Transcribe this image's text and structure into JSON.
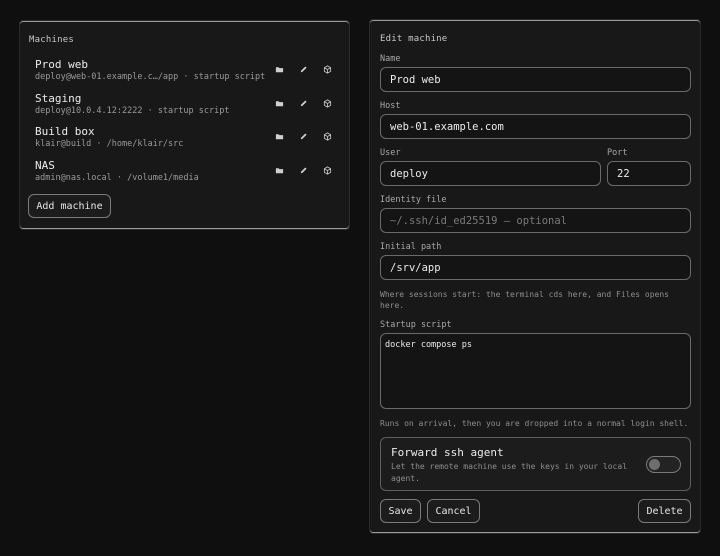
{
  "machines_panel": {
    "title": "Machines",
    "items": [
      {
        "name": "Prod web",
        "detail": "deploy@web-01.example.c…/app  ·  startup script"
      },
      {
        "name": "Staging",
        "detail": "deploy@10.0.4.12:2222  ·  startup script"
      },
      {
        "name": "Build box",
        "detail": "klair@build  ·  /home/klair/src"
      },
      {
        "name": "NAS",
        "detail": "admin@nas.local  ·  /volume1/media"
      }
    ],
    "row_icons": [
      "folder-icon",
      "pencil-icon",
      "box-icon"
    ],
    "add_button": "Add machine"
  },
  "edit_panel": {
    "title": "Edit machine",
    "name_label": "Name",
    "name_value": "Prod web",
    "host_label": "Host",
    "host_value": "web-01.example.com",
    "user_label": "User",
    "user_value": "deploy",
    "port_label": "Port",
    "port_value": "22",
    "identity_label": "Identity file",
    "identity_placeholder": "~/.ssh/id_ed25519 — optional",
    "path_label": "Initial path",
    "path_value": "/srv/app",
    "path_hint": "Where sessions start: the terminal cds here, and Files opens here.",
    "script_label": "Startup script",
    "script_value": "docker compose ps",
    "script_hint": "Runs on arrival, then you are dropped into a normal login shell.",
    "agent_title": "Forward ssh agent",
    "agent_desc": "Let the remote machine use the keys in your local agent.",
    "agent_enabled": false,
    "save": "Save",
    "cancel": "Cancel",
    "delete": "Delete"
  }
}
